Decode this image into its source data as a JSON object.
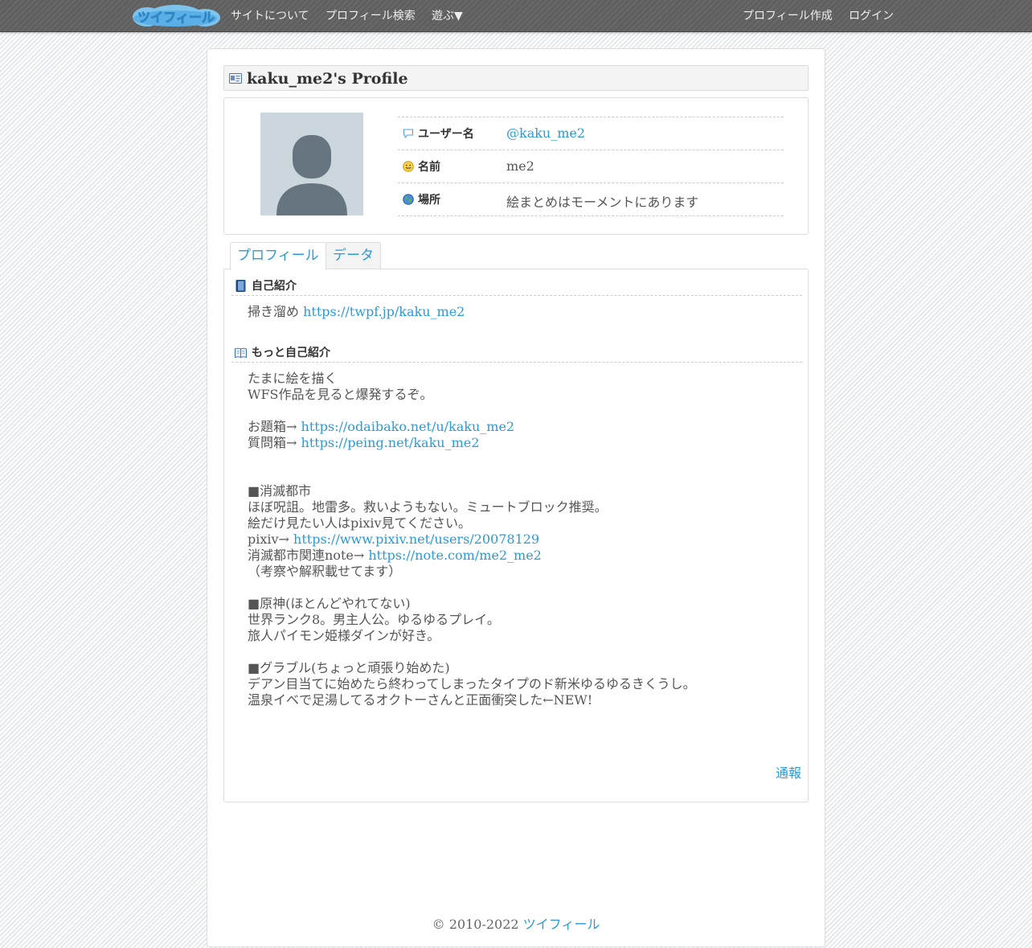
{
  "nav": {
    "logo_text": "ツイフィール",
    "links": {
      "about": "サイトについて",
      "search": "プロフィール検索",
      "play": "遊ぶ▼",
      "create": "プロフィール作成",
      "login": "ログイン"
    }
  },
  "profile": {
    "title": "kaku_me2's Profile",
    "rows": {
      "username": {
        "label": "ユーザー名",
        "value": "@kaku_me2"
      },
      "name": {
        "label": "名前",
        "value": "me2"
      },
      "location": {
        "label": "場所",
        "value": "絵まとめはモーメントにあります"
      }
    }
  },
  "tabs": {
    "profile": "プロフィール",
    "data": "データ"
  },
  "intro": {
    "title": "自己紹介",
    "prefix": "掃き溜め",
    "link": "https://twpf.jp/kaku_me2"
  },
  "more_intro": {
    "title": "もっと自己紹介",
    "lines": {
      "l1": "たまに絵を描く",
      "l2": "WFS作品を見ると爆発するぞ。",
      "l3_prefix": "お題箱→",
      "l3_link": "https://odaibako.net/u/kaku_me2",
      "l4_prefix": "質問箱→",
      "l4_link": "https://peing.net/kaku_me2",
      "l5": "■消滅都市",
      "l6": "ほぼ呪詛。地雷多。救いようもない。ミュートブロック推奨。",
      "l7": "絵だけ見たい人はpixiv見てください。",
      "l8_prefix": "pixiv→",
      "l8_link": "https://www.pixiv.net/users/20078129",
      "l9_prefix": "消滅都市関連note→",
      "l9_link": "https://note.com/me2_me2",
      "l10": "（考察や解釈載せてます）",
      "l11": "■原神(ほとんどやれてない)",
      "l12": "世界ランク8。男主人公。ゆるゆるプレイ。",
      "l13": "旅人パイモン姫様ダインが好き。",
      "l14": "■グラブル(ちょっと頑張り始めた)",
      "l15": "デアン目当てに始めたら終わってしまったタイプのド新米ゆるゆるきくうし。",
      "l16": "温泉イベで足湯してるオクトーさんと正面衝突した←NEW!"
    }
  },
  "report": "通報",
  "footer": {
    "copyright": "© 2010-2022",
    "site": "ツイフィール"
  },
  "colors": {
    "link": "#2b9ad6",
    "navbar": "#5f5f5f",
    "avatar_bg": "#ccd6dd",
    "avatar_fg": "#66757f"
  }
}
